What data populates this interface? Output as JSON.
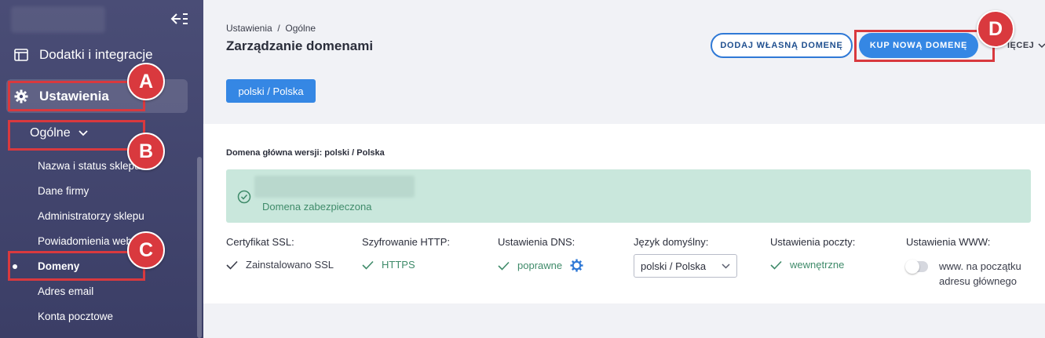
{
  "sidebar": {
    "addons_label": "Dodatki i integracje",
    "settings_label": "Ustawienia",
    "general_label": "Ogólne",
    "links": [
      "Nazwa i status sklepu",
      "Dane firmy",
      "Administratorzy sklepu",
      "Powiadomienia web",
      "Domeny",
      "Adres email",
      "Konta pocztowe"
    ]
  },
  "header": {
    "breadcrumb": "Ustawienia  /  Ogólne",
    "title": "Zarządzanie domenami",
    "add_domain_button": "DODAJ WŁASNĄ DOMENĘ",
    "buy_domain_button": "KUP NOWĄ DOMENĘ",
    "more_label": "IĘCEJ"
  },
  "language_button": "polski / Polska",
  "main_domain": {
    "label": "Domena główna wersji: polski / Polska",
    "status": "Domena zabezpieczona"
  },
  "columns": {
    "ssl": {
      "heading": "Certyfikat SSL:",
      "value": "Zainstalowano SSL"
    },
    "http": {
      "heading": "Szyfrowanie HTTP:",
      "value": "HTTPS"
    },
    "dns": {
      "heading": "Ustawienia DNS:",
      "value": "poprawne"
    },
    "lang": {
      "heading": "Język domyślny:",
      "value": "polski / Polska"
    },
    "mail": {
      "heading": "Ustawienia poczty:",
      "value": "wewnętrzne"
    },
    "www": {
      "heading": "Ustawienia WWW:",
      "value": "www. na początku adresu głównego"
    }
  },
  "markers": {
    "a": "A",
    "b": "B",
    "c": "C",
    "d": "D"
  },
  "colors": {
    "accent": "#3587e4",
    "annotation": "#d9393e",
    "success_bg": "#c9e7dc",
    "success_text": "#3f8b6a"
  }
}
